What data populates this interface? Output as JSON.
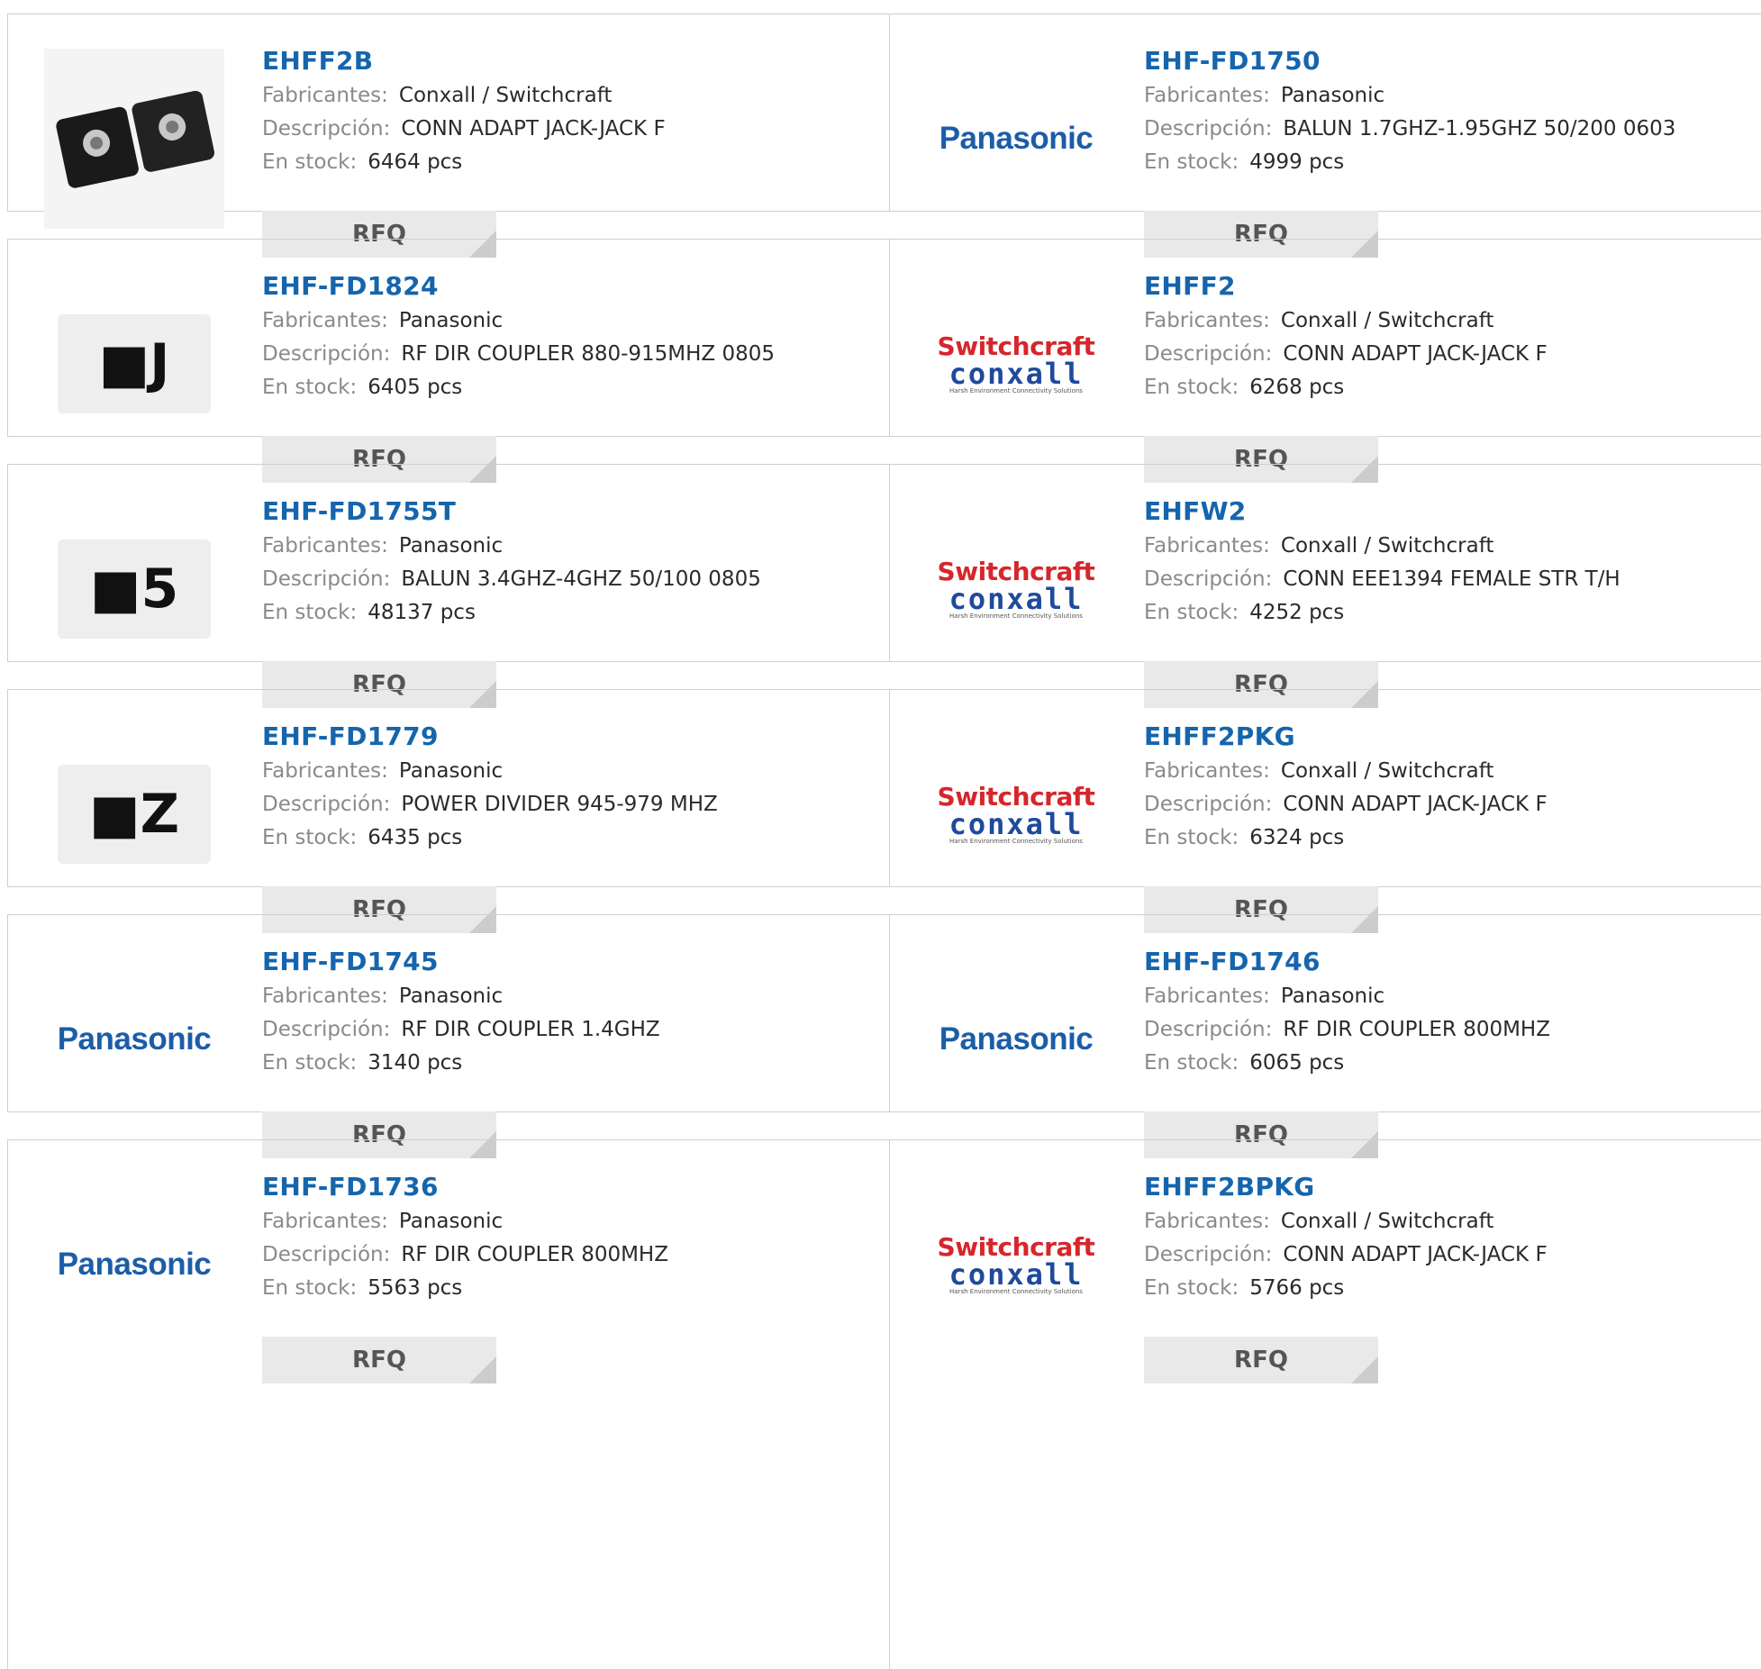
{
  "labels": {
    "manufacturer": "Fabricantes:",
    "description": "Descripción:",
    "stock": "En stock:",
    "rfq": "RFQ"
  },
  "products": [
    {
      "pn": "EHFF2B",
      "mfr": "Conxall / Switchcraft",
      "desc": "CONN ADAPT JACK-JACK F",
      "stock": "6464 pcs",
      "image": "connector-panel-photo"
    },
    {
      "pn": "EHF-FD1750",
      "mfr": "Panasonic",
      "desc": "BALUN 1.7GHZ-1.95GHZ 50/200 0603",
      "stock": "4999 pcs",
      "image": "panasonic-logo",
      "logo_text": "Panasonic"
    },
    {
      "pn": "EHF-FD1824",
      "mfr": "Panasonic",
      "desc": "RF DIR COUPLER 880-915MHZ 0805",
      "stock": "6405 pcs",
      "image": "chip-photo",
      "chip_mark": "■J"
    },
    {
      "pn": "EHFF2",
      "mfr": "Conxall / Switchcraft",
      "desc": "CONN ADAPT JACK-JACK F",
      "stock": "6268 pcs",
      "image": "switchcraft-conxall-logo",
      "logo_text": "Switchcraft",
      "logo_text2": "conxall",
      "logo_tagline": "Harsh Environment Connectivity Solutions"
    },
    {
      "pn": "EHF-FD1755T",
      "mfr": "Panasonic",
      "desc": "BALUN 3.4GHZ-4GHZ 50/100 0805",
      "stock": "48137 pcs",
      "image": "chip-photo",
      "chip_mark": "■5"
    },
    {
      "pn": "EHFW2",
      "mfr": "Conxall / Switchcraft",
      "desc": "CONN EEE1394 FEMALE STR T/H",
      "stock": "4252 pcs",
      "image": "switchcraft-conxall-logo",
      "logo_text": "Switchcraft",
      "logo_text2": "conxall",
      "logo_tagline": "Harsh Environment Connectivity Solutions"
    },
    {
      "pn": "EHF-FD1779",
      "mfr": "Panasonic",
      "desc": "POWER DIVIDER 945-979 MHZ",
      "stock": "6435 pcs",
      "image": "chip-photo",
      "chip_mark": "■Z"
    },
    {
      "pn": "EHFF2PKG",
      "mfr": "Conxall / Switchcraft",
      "desc": "CONN ADAPT JACK-JACK F",
      "stock": "6324 pcs",
      "image": "switchcraft-conxall-logo",
      "logo_text": "Switchcraft",
      "logo_text2": "conxall",
      "logo_tagline": "Harsh Environment Connectivity Solutions"
    },
    {
      "pn": "EHF-FD1745",
      "mfr": "Panasonic",
      "desc": "RF DIR COUPLER 1.4GHZ",
      "stock": "3140 pcs",
      "image": "panasonic-logo",
      "logo_text": "Panasonic"
    },
    {
      "pn": "EHF-FD1746",
      "mfr": "Panasonic",
      "desc": "RF DIR COUPLER 800MHZ",
      "stock": "6065 pcs",
      "image": "panasonic-logo",
      "logo_text": "Panasonic"
    },
    {
      "pn": "EHF-FD1736",
      "mfr": "Panasonic",
      "desc": "RF DIR COUPLER 800MHZ",
      "stock": "5563 pcs",
      "image": "panasonic-logo",
      "logo_text": "Panasonic"
    },
    {
      "pn": "EHFF2BPKG",
      "mfr": "Conxall / Switchcraft",
      "desc": "CONN ADAPT JACK-JACK F",
      "stock": "5766 pcs",
      "image": "switchcraft-conxall-logo",
      "logo_text": "Switchcraft",
      "logo_text2": "conxall",
      "logo_tagline": "Harsh Environment Connectivity Solutions"
    }
  ]
}
